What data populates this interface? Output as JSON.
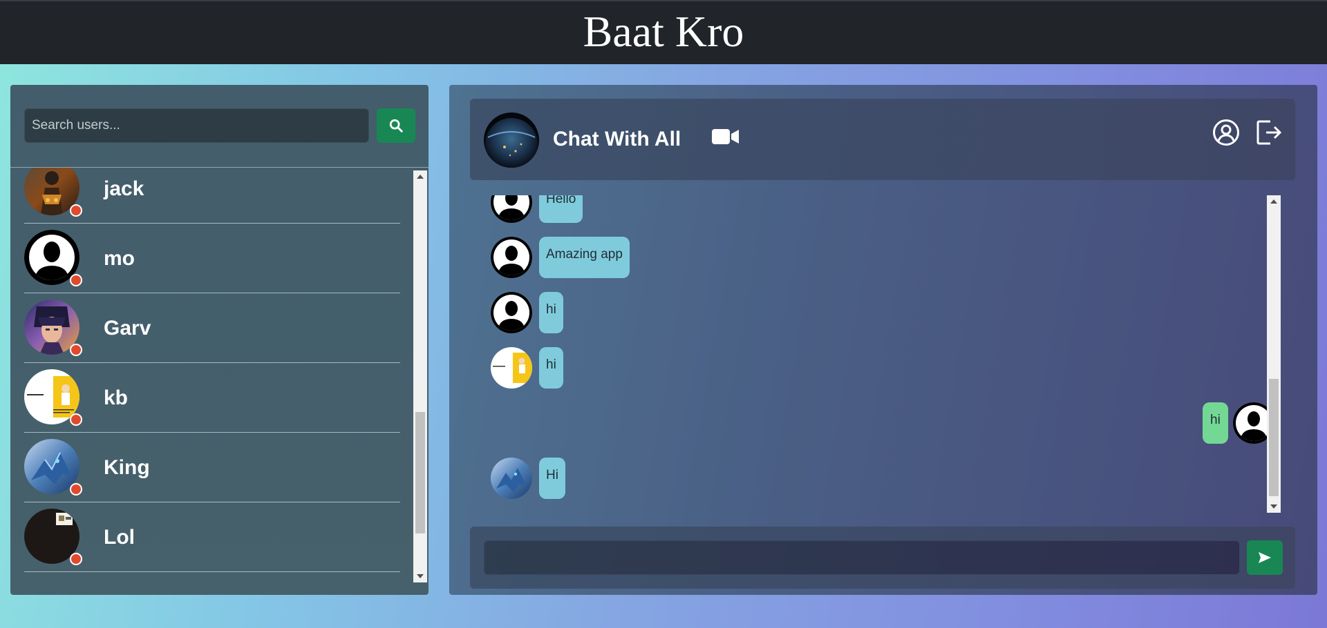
{
  "app": {
    "title": "Baat Kro"
  },
  "sidebar": {
    "search_placeholder": "Search users...",
    "users": [
      {
        "name": "jack",
        "avatar": "warrior-avatar",
        "status": "offline"
      },
      {
        "name": "mo",
        "avatar": "default-silhouette-avatar",
        "status": "offline"
      },
      {
        "name": "Garv",
        "avatar": "anime-portrait-avatar",
        "status": "offline"
      },
      {
        "name": "kb",
        "avatar": "document-thumbnail-avatar",
        "status": "offline"
      },
      {
        "name": "King",
        "avatar": "dragon-avatar",
        "status": "offline"
      },
      {
        "name": "Lol",
        "avatar": "dark-image-avatar",
        "status": "offline"
      }
    ]
  },
  "chat": {
    "title": "Chat With All",
    "avatar": "earth-avatar",
    "messages": [
      {
        "text": "Hello",
        "from": "other",
        "avatar": "default-silhouette-avatar"
      },
      {
        "text": "Amazing app",
        "from": "other",
        "avatar": "default-silhouette-avatar"
      },
      {
        "text": "hi",
        "from": "other",
        "avatar": "default-silhouette-avatar"
      },
      {
        "text": "hi",
        "from": "other",
        "avatar": "document-thumbnail-avatar"
      },
      {
        "text": "hi",
        "from": "self",
        "avatar": "default-silhouette-avatar"
      },
      {
        "text": "Hi",
        "from": "other",
        "avatar": "dragon-avatar"
      }
    ],
    "composer_value": ""
  },
  "colors": {
    "accent_green": "#198754",
    "status_red": "#e04a2e",
    "bubble_incoming": "#7fcbdc",
    "bubble_outgoing": "#74d895"
  }
}
